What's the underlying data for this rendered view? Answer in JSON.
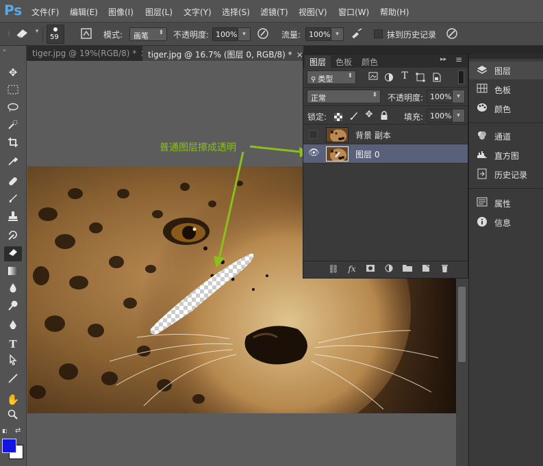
{
  "app": {
    "logo": "Ps"
  },
  "menu": [
    "文件(F)",
    "编辑(E)",
    "图像(I)",
    "图层(L)",
    "文字(Y)",
    "选择(S)",
    "滤镜(T)",
    "视图(V)",
    "窗口(W)",
    "帮助(H)"
  ],
  "options": {
    "brush_size": "59",
    "mode_label": "模式:",
    "mode_value": "画笔",
    "opacity_label": "不透明度:",
    "opacity_value": "100%",
    "flow_label": "流量:",
    "flow_value": "100%",
    "erase_history_label": "抹到历史记录"
  },
  "tabs": [
    {
      "label": "tiger.jpg @ 19%(RGB/8) *",
      "close": "×"
    },
    {
      "label": "tiger.jpg @ 16.7% (图层 0, RGB/8) *",
      "close": "×"
    }
  ],
  "layers_panel": {
    "tabs": [
      "图层",
      "色板",
      "颜色"
    ],
    "filter_kind": "类型",
    "blend_mode": "正常",
    "opacity_label": "不透明度:",
    "opacity_value": "100%",
    "lock_label": "锁定:",
    "fill_label": "填充:",
    "fill_value": "100%",
    "layers": [
      {
        "name": "背景 副本",
        "visible": false,
        "selected": false
      },
      {
        "name": "图层 0",
        "visible": true,
        "selected": true
      }
    ],
    "bottom_icons": [
      "link-icon",
      "fx-icon",
      "mask-icon",
      "adjustment-icon",
      "folder-icon",
      "new-layer-icon",
      "trash-icon"
    ]
  },
  "dock": [
    {
      "label": "图层",
      "icon": "layers-icon",
      "active": true
    },
    {
      "label": "色板",
      "icon": "swatches-icon"
    },
    {
      "label": "颜色",
      "icon": "color-icon"
    },
    {
      "label": "通道",
      "icon": "channels-icon"
    },
    {
      "label": "直方图",
      "icon": "histogram-icon"
    },
    {
      "label": "历史记录",
      "icon": "history-icon"
    },
    {
      "label": "属性",
      "icon": "properties-icon"
    },
    {
      "label": "信息",
      "icon": "info-icon"
    }
  ],
  "annotation": {
    "text": "普通图层擦成透明"
  },
  "colors": {
    "foreground": "#1414e0",
    "background": "#ffffff",
    "annotation": "#8cbf1b",
    "accent": "#58a9e6"
  }
}
